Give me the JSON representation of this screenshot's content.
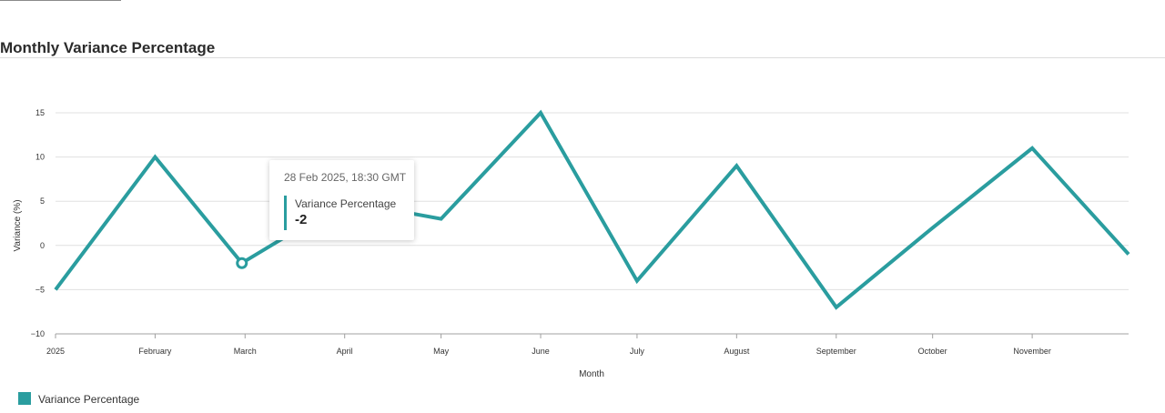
{
  "page": {
    "title": "Monthly Variance Percentage"
  },
  "colors": {
    "series": "#2a9d9f",
    "grid": "#e0e0e0",
    "axis": "#a0a0a0"
  },
  "chart_data": {
    "type": "line",
    "title": "",
    "xlabel": "Month",
    "ylabel": "Variance (%)",
    "ylim": [
      -10,
      15
    ],
    "yticks": [
      "15",
      "10",
      "5",
      "0",
      "−5",
      "−10"
    ],
    "ytick_values": [
      15,
      10,
      5,
      0,
      -5,
      -10
    ],
    "xticks": [
      "2025",
      "February",
      "March",
      "April",
      "May",
      "June",
      "July",
      "August",
      "September",
      "October",
      "November"
    ],
    "x": [
      "2025-01-01",
      "2025-02-01",
      "2025-02-28",
      "2025-04-01",
      "2025-05-01",
      "2025-06-01",
      "2025-07-01",
      "2025-08-01",
      "2025-09-01",
      "2025-10-01",
      "2025-11-01",
      "2025-12-01"
    ],
    "series": [
      {
        "name": "Variance Percentage",
        "values": [
          -5,
          10,
          -2,
          5,
          3,
          15,
          -4,
          9,
          -7,
          2,
          11,
          -1
        ]
      }
    ],
    "grid": true,
    "legend": "bottom-left"
  },
  "tooltip": {
    "date": "28 Feb 2025, 18:30 GMT",
    "series_name": "Variance Percentage",
    "value": "-2"
  }
}
